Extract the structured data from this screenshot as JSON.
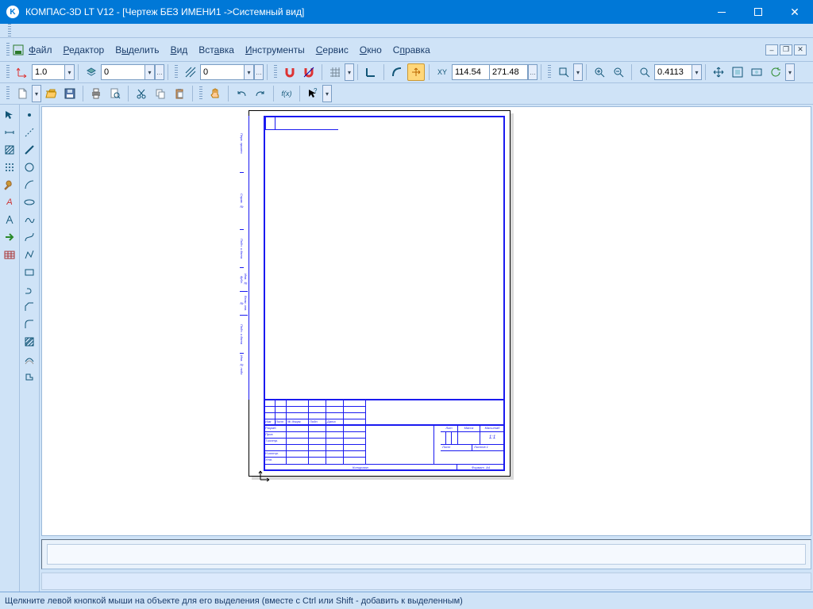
{
  "title": "КОМПАС-3D LT V12 - [Чертеж БЕЗ ИМЕНИ1 ->Системный вид]",
  "app_icon_letter": "K",
  "menu": {
    "file": "Файл",
    "editor": "Редактор",
    "select": "Выделить",
    "view": "Вид",
    "insert": "Вставка",
    "tools": "Инструменты",
    "service": "Сервис",
    "window": "Окно",
    "help": "Справка"
  },
  "toolbar1": {
    "scale": "1.0",
    "layer": "0",
    "style": "0",
    "coord_x": "114.54",
    "coord_y": "271.48",
    "zoom": "0.4113"
  },
  "statusbar": "Щелкните левой кнопкой мыши на объекте для его выделения (вместе с Ctrl или Shift - добавить к выделенным)",
  "titleblock": {
    "lit": "Лит",
    "massa": "Масса",
    "masshtab": "Масштаб",
    "ratio": "1:1",
    "list": "Лист",
    "listov": "Листов 1",
    "izm": "Изм",
    "doc": "№ докум.",
    "podp": "Подп.",
    "data": "Дата",
    "razrab": "Разраб.",
    "prov": "Пров.",
    "tkontr": "Т.контр.",
    "nkontr": "Н.контр.",
    "utv": "Утв.",
    "kopiroval": "Копировал",
    "format": "Формат",
    "a4": "A4",
    "side1": "Перв. примен.",
    "side2": "Справ. №",
    "side3": "Подп. и дата",
    "side4": "Инв. № дубл.",
    "side5": "Взам. инв. №",
    "side6": "Подп. и дата",
    "side7": "Инв. № подл."
  }
}
